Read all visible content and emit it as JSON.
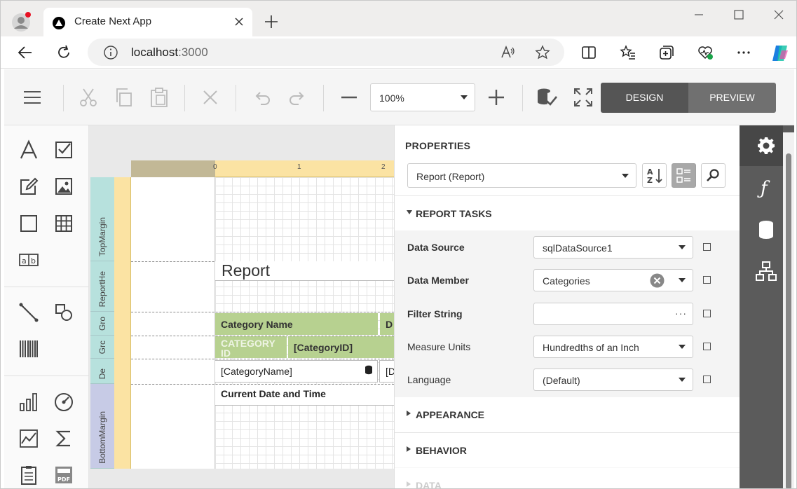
{
  "browser": {
    "tab_title": "Create Next App",
    "address_host": "localhost",
    "address_port": ":3000"
  },
  "toolbar": {
    "zoom": "100%",
    "design_label": "DESIGN",
    "preview_label": "PREVIEW"
  },
  "canvas": {
    "ruler_marks": [
      "0",
      "1",
      "2"
    ],
    "bands": [
      "TopMargin",
      "ReportHe",
      "Gro",
      "Grc",
      "De",
      "BottomMargin"
    ],
    "report_title": "Report",
    "header_cells": [
      "Category Name",
      "D"
    ],
    "group_cells": [
      "CATEGORY ID",
      "[CategoryID]"
    ],
    "detail_cells": [
      "[CategoryName]",
      "[D"
    ],
    "footer_cell": "Current Date and Time"
  },
  "properties": {
    "title": "PROPERTIES",
    "object": "Report (Report)",
    "sections": {
      "tasks": "REPORT TASKS",
      "appearance": "APPEARANCE",
      "behavior": "BEHAVIOR",
      "data": "DATA"
    },
    "rows": [
      {
        "label": "Data Source",
        "value": "sqlDataSource1"
      },
      {
        "label": "Data Member",
        "value": "Categories"
      },
      {
        "label": "Filter String",
        "value": ""
      },
      {
        "label": "Measure Units",
        "value": "Hundredths of an Inch"
      },
      {
        "label": "Language",
        "value": "(Default)"
      }
    ]
  },
  "colors": {
    "accent_dark": "#555555",
    "band_header": "#b7d190",
    "ruler": "#fbe3a3"
  }
}
